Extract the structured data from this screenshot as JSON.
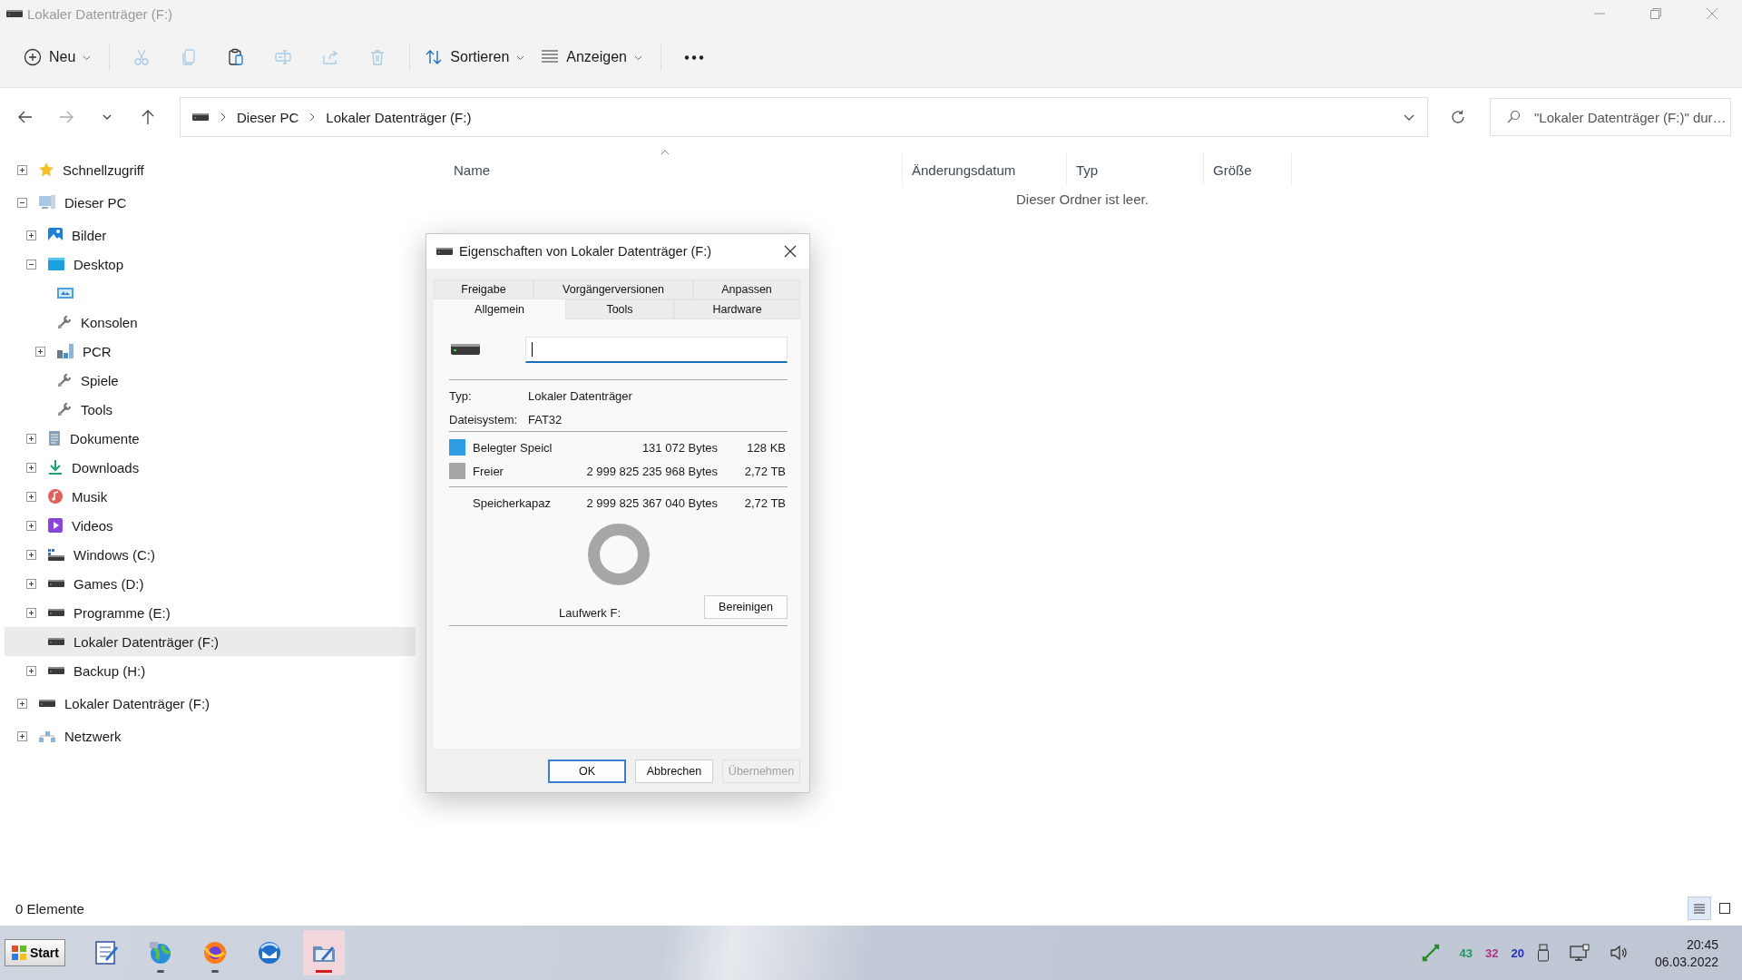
{
  "window": {
    "title": "Lokaler Datenträger (F:)",
    "active": false
  },
  "toolbar": [
    {
      "kind": "new",
      "label": "Neu",
      "disabled": false,
      "dropdown": true
    },
    {
      "kind": "cut",
      "disabled": true,
      "dropdown": false
    },
    {
      "kind": "copy",
      "disabled": true,
      "dropdown": false
    },
    {
      "kind": "paste",
      "disabled": false,
      "dropdown": false
    },
    {
      "kind": "rename",
      "disabled": true,
      "dropdown": false
    },
    {
      "kind": "share",
      "disabled": true,
      "dropdown": false
    },
    {
      "kind": "delete",
      "disabled": true,
      "dropdown": false
    },
    {
      "kind": "sort",
      "label": "Sortieren",
      "disabled": false,
      "dropdown": true
    },
    {
      "kind": "view",
      "label": "Anzeigen",
      "disabled": false,
      "dropdown": true
    },
    {
      "kind": "more",
      "disabled": false,
      "dropdown": false
    }
  ],
  "navigation": [
    {
      "kind": "back",
      "disabled": false
    },
    {
      "kind": "forward",
      "disabled": true
    },
    {
      "kind": "recent",
      "disabled": false
    },
    {
      "kind": "up",
      "disabled": false
    }
  ],
  "address": {
    "breadcrumbs": [
      "Dieser PC",
      "Lokaler Datenträger (F:)"
    ]
  },
  "search": {
    "placeholder": "\"Lokaler Datenträger (F:)\" dur…"
  },
  "columns": [
    {
      "label": "Name",
      "sorted": true
    },
    {
      "label": "Änderungsdatum",
      "sorted": false
    },
    {
      "label": "Typ",
      "sorted": false
    },
    {
      "label": "Größe",
      "sorted": false
    }
  ],
  "empty_message": "Dieser Ordner ist leer.",
  "sidebar": {
    "items": [
      {
        "label": "Schnellzugriff",
        "kind": "star",
        "expanded": false,
        "selected": false
      },
      {
        "label": "Dieser PC",
        "kind": "pc",
        "expanded": true,
        "selected": false,
        "children": [
          {
            "label": "Bilder",
            "kind": "pictures",
            "expanded": false,
            "selected": false
          },
          {
            "label": "Desktop",
            "kind": "desktop",
            "expanded": true,
            "selected": false,
            "children": [
              {
                "kind": "screen",
                "selected": false
              },
              {
                "label": "Konsolen",
                "kind": "tools",
                "selected": false
              },
              {
                "label": "PCR",
                "kind": "city",
                "expanded": false,
                "selected": false
              },
              {
                "label": "Spiele",
                "kind": "tools",
                "selected": false
              },
              {
                "label": "Tools",
                "kind": "tools",
                "selected": false
              }
            ]
          },
          {
            "label": "Dokumente",
            "kind": "documents",
            "expanded": false,
            "selected": false
          },
          {
            "label": "Downloads",
            "kind": "downloads",
            "expanded": false,
            "selected": false
          },
          {
            "label": "Musik",
            "kind": "music",
            "expanded": false,
            "selected": false
          },
          {
            "label": "Videos",
            "kind": "videos",
            "expanded": false,
            "selected": false
          },
          {
            "label": "Windows (C:)",
            "kind": "system-drive",
            "expanded": false,
            "selected": false
          },
          {
            "label": "Games (D:)",
            "kind": "drive",
            "expanded": false,
            "selected": false
          },
          {
            "label": "Programme (E:)",
            "kind": "drive",
            "expanded": false,
            "selected": false
          },
          {
            "label": "Lokaler Datenträger (F:)",
            "kind": "drive",
            "selected": true
          },
          {
            "label": "Backup (H:)",
            "kind": "drive",
            "expanded": false,
            "selected": false
          }
        ]
      },
      {
        "label": "Lokaler Datenträger (F:)",
        "kind": "drive",
        "expanded": false,
        "selected": false
      },
      {
        "label": "Netzwerk",
        "kind": "network",
        "expanded": false,
        "selected": false
      }
    ]
  },
  "dialog": {
    "title": "Eigenschaften von Lokaler Datenträger (F:)",
    "tab_rows": [
      [
        {
          "label": "Freigabe",
          "selected": false
        },
        {
          "label": "Vorgängerversionen",
          "selected": false
        },
        {
          "label": "Anpassen",
          "selected": false
        }
      ],
      [
        {
          "label": "Allgemein",
          "selected": true
        },
        {
          "label": "Tools",
          "selected": false
        },
        {
          "label": "Hardware",
          "selected": false
        }
      ]
    ],
    "properties": [
      {
        "label": "Typ:",
        "value": "Lokaler Datenträger"
      },
      {
        "label": "Dateisystem:",
        "value": "FAT32"
      }
    ],
    "usage": [
      {
        "label": "Belegter Speicl",
        "bytes": "131 072 Bytes",
        "size": "128 KB",
        "color": "#2e9de4"
      },
      {
        "label": "Freier",
        "bytes": "2 999 825 235 968 Bytes",
        "size": "2,72 TB",
        "color": "#a6a6a6"
      }
    ],
    "capacity": {
      "label": "Speicherkapaz",
      "bytes": "2 999 825 367 040 Bytes",
      "size": "2,72 TB"
    },
    "drive_label": "Laufwerk F:",
    "cleanup_button": "Bereinigen",
    "buttons": [
      {
        "label": "OK",
        "default": true,
        "disabled": false
      },
      {
        "label": "Abbrechen",
        "default": false,
        "disabled": false
      },
      {
        "label": "Übernehmen",
        "default": false,
        "disabled": true
      }
    ]
  },
  "status_bar": {
    "count": "0 Elemente",
    "views": [
      {
        "kind": "details",
        "selected": true
      },
      {
        "kind": "tiles",
        "selected": false
      }
    ]
  },
  "taskbar": {
    "start": "Start",
    "apps": [
      {
        "kind": "notepad",
        "running": false,
        "active": false
      },
      {
        "kind": "globe",
        "running": true,
        "active": false
      },
      {
        "kind": "browser",
        "running": true,
        "active": false
      },
      {
        "kind": "mail",
        "running": false,
        "active": false
      },
      {
        "kind": "explorer",
        "running": true,
        "active": true
      }
    ],
    "tray": [
      {
        "kind": "arrows"
      },
      {
        "kind": "number",
        "text": "43",
        "color": "#1a9a5a"
      },
      {
        "kind": "number",
        "text": "32",
        "color": "#b0308a"
      },
      {
        "kind": "number",
        "text": "20",
        "color": "#2030c0"
      },
      {
        "kind": "usb"
      },
      {
        "kind": "network"
      },
      {
        "kind": "volume"
      }
    ],
    "time": "20:45",
    "date": "06.03.2022"
  }
}
